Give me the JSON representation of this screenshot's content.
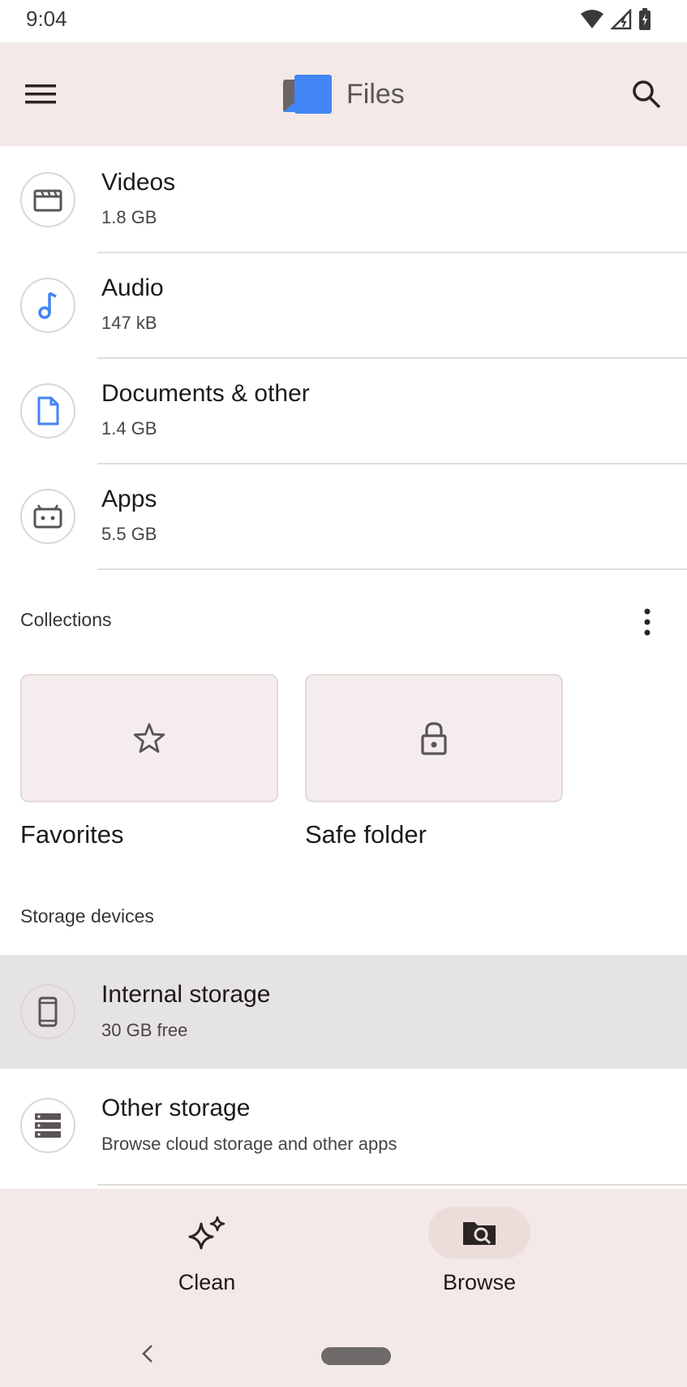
{
  "status_bar": {
    "time": "9:04"
  },
  "app_bar": {
    "title": "Files"
  },
  "categories": [
    {
      "title": "Videos",
      "size": "1.8 GB",
      "icon": "video-icon"
    },
    {
      "title": "Audio",
      "size": "147 kB",
      "icon": "music-note-icon"
    },
    {
      "title": "Documents & other",
      "size": "1.4 GB",
      "icon": "document-icon"
    },
    {
      "title": "Apps",
      "size": "5.5 GB",
      "icon": "android-icon"
    }
  ],
  "collections": {
    "label": "Collections",
    "items": [
      {
        "label": "Favorites",
        "icon": "star-icon"
      },
      {
        "label": "Safe folder",
        "icon": "lock-icon"
      }
    ]
  },
  "storage": {
    "label": "Storage devices",
    "items": [
      {
        "title": "Internal storage",
        "subtitle": "30 GB free",
        "icon": "phone-icon"
      },
      {
        "title": "Other storage",
        "subtitle": "Browse cloud storage and other apps",
        "icon": "storage-icon"
      }
    ]
  },
  "bottom_nav": {
    "items": [
      {
        "label": "Clean",
        "icon": "sparkle-icon",
        "selected": false
      },
      {
        "label": "Browse",
        "icon": "browse-folder-icon",
        "selected": true
      }
    ]
  },
  "colors": {
    "app_bar_bg": "#f3e9e7",
    "accent_blue": "#4285f4",
    "selected_row": "#e6e3e3"
  }
}
